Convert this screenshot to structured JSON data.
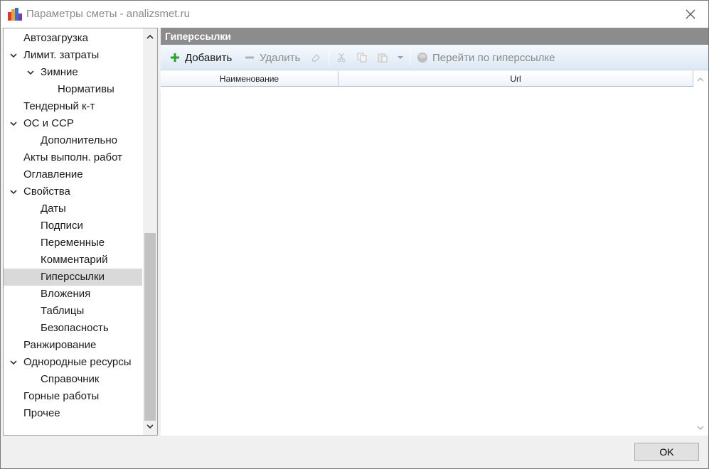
{
  "window": {
    "title": "Параметры сметы - analizsmet.ru"
  },
  "tree": {
    "items": [
      {
        "label": "Автозагрузка",
        "level": 0,
        "expanded": null,
        "selected": false
      },
      {
        "label": "Лимит. затраты",
        "level": 0,
        "expanded": true,
        "selected": false
      },
      {
        "label": "Зимние",
        "level": 1,
        "expanded": true,
        "selected": false
      },
      {
        "label": "Нормативы",
        "level": 2,
        "expanded": null,
        "selected": false
      },
      {
        "label": "Тендерный к-т",
        "level": 0,
        "expanded": null,
        "selected": false
      },
      {
        "label": "ОС и ССР",
        "level": 0,
        "expanded": true,
        "selected": false
      },
      {
        "label": "Дополнительно",
        "level": 1,
        "expanded": null,
        "selected": false
      },
      {
        "label": "Акты выполн. работ",
        "level": 0,
        "expanded": null,
        "selected": false
      },
      {
        "label": "Оглавление",
        "level": 0,
        "expanded": null,
        "selected": false
      },
      {
        "label": "Свойства",
        "level": 0,
        "expanded": true,
        "selected": false
      },
      {
        "label": "Даты",
        "level": 1,
        "expanded": null,
        "selected": false
      },
      {
        "label": "Подписи",
        "level": 1,
        "expanded": null,
        "selected": false
      },
      {
        "label": "Переменные",
        "level": 1,
        "expanded": null,
        "selected": false
      },
      {
        "label": "Комментарий",
        "level": 1,
        "expanded": null,
        "selected": false
      },
      {
        "label": "Гиперссылки",
        "level": 1,
        "expanded": null,
        "selected": true
      },
      {
        "label": "Вложения",
        "level": 1,
        "expanded": null,
        "selected": false
      },
      {
        "label": "Таблицы",
        "level": 1,
        "expanded": null,
        "selected": false
      },
      {
        "label": "Безопасность",
        "level": 1,
        "expanded": null,
        "selected": false
      },
      {
        "label": "Ранжирование",
        "level": 0,
        "expanded": null,
        "selected": false
      },
      {
        "label": "Однородные ресурсы",
        "level": 0,
        "expanded": true,
        "selected": false
      },
      {
        "label": "Справочник",
        "level": 1,
        "expanded": null,
        "selected": false
      },
      {
        "label": "Горные работы",
        "level": 0,
        "expanded": null,
        "selected": false
      },
      {
        "label": "Прочее",
        "level": 0,
        "expanded": null,
        "selected": false
      }
    ]
  },
  "panel": {
    "title": "Гиперссылки",
    "toolbar": {
      "add_label": "Добавить",
      "delete_label": "Удалить",
      "goto_label": "Перейти по гиперссылке"
    },
    "grid": {
      "columns": [
        "Наименование",
        "Url"
      ],
      "rows": []
    }
  },
  "footer": {
    "ok_label": "OK"
  },
  "colors": {
    "add_icon": "#2e9e2e",
    "disabled_text": "#8a8a8a",
    "header_bg": "#8c8c8c",
    "selected_row": "#d9d9d9"
  }
}
